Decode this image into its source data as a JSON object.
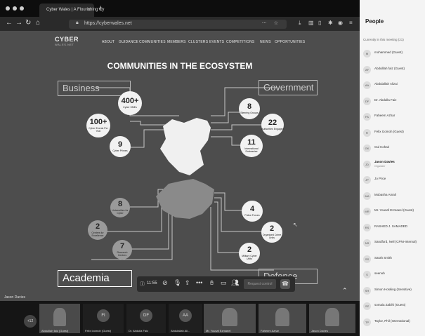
{
  "browser": {
    "tab_title": "Cyber Wales | A Flourishing Cy",
    "url": "https://cyberwales.net"
  },
  "site": {
    "logo_text": "CYBER",
    "logo_sub": "WALES.NET",
    "nav": [
      "ABOUT",
      "GUIDANCE",
      "COMMUNITIES",
      "MEMBERS",
      "CLUSTERS",
      "EVENTS",
      "COMPETITIONS",
      "NEWS",
      "OPPORTUNITIES"
    ],
    "title": "COMMUNITIES IN THE ECOSYSTEM",
    "sectors": {
      "business": "Business",
      "government": "Government",
      "academia": "Academia",
      "defence": "Defence"
    },
    "stats": {
      "business": [
        {
          "n": "400+",
          "l": "Cyber SMEs"
        },
        {
          "n": "100+",
          "l": "Cyber Events Per Year"
        },
        {
          "n": "9",
          "l": "Cyber Primes"
        }
      ],
      "government": [
        {
          "n": "8",
          "l": "Steering Groups"
        },
        {
          "n": "22",
          "l": "Authorities Engaged"
        },
        {
          "n": "11",
          "l": "International Embassies"
        }
      ],
      "academia": [
        {
          "n": "8",
          "l": "Universities for Cyber"
        },
        {
          "n": "2",
          "l": "Centres for Excellence"
        },
        {
          "n": "7",
          "l": "Research Centres"
        }
      ],
      "defence": [
        {
          "n": "4",
          "l": "Police Forces"
        },
        {
          "n": "2",
          "l": "Organised Crime Units"
        },
        {
          "n": "2",
          "l": "Military Cyber Units"
        }
      ]
    }
  },
  "call": {
    "timer": "11:55",
    "request_control": "Request control",
    "presenter": "Jason Davies"
  },
  "people": {
    "title": "People",
    "section": "Currently in this meeting (21)",
    "list": [
      {
        "i": "M",
        "name": "mohammed (Guest)"
      },
      {
        "i": "AF",
        "name": "Abdulllah faiz (Guest)"
      },
      {
        "i": "AA",
        "name": "Abdulallah Alizai"
      },
      {
        "i": "DF",
        "name": "Dr. Abdulla Faiz"
      },
      {
        "i": "FA",
        "name": "Faheem Azhar"
      },
      {
        "i": "FI",
        "name": "Felix Izomoh (Guest)"
      },
      {
        "i": "GK",
        "name": "Gul Kohari"
      },
      {
        "i": "JD",
        "name": "Jason Davies",
        "role": "Organizer"
      },
      {
        "i": "JP",
        "name": "Jo Price"
      },
      {
        "i": "MA",
        "name": "Mobasha Amali"
      },
      {
        "i": "MR",
        "name": "Mr. Yousaf Ezmaeel (Guest)"
      },
      {
        "i": "RS",
        "name": "RASHED J. SAMADED"
      },
      {
        "i": "NS",
        "name": "Sandford, Neil (CPNI-Internal)"
      },
      {
        "i": "SS",
        "name": "Sarah Smith"
      },
      {
        "i": "S",
        "name": "seenub"
      },
      {
        "i": "SH",
        "name": "Simon Hosking (Sensitive)"
      },
      {
        "i": "SZ",
        "name": "somaia Zabihi (Guest)"
      },
      {
        "i": "TP",
        "name": "Taylor, Phil (International)"
      }
    ]
  },
  "participants_strip": {
    "overflow": "+12",
    "tiles": [
      {
        "i": "",
        "name": "Abdulllah faiz (Guest)"
      },
      {
        "i": "FI",
        "name": "Felix Izomoh (Guest)"
      },
      {
        "i": "DF",
        "name": "Dr. Abdulla Faiz"
      },
      {
        "i": "AA",
        "name": "Abdulallah Ali..."
      },
      {
        "i": "",
        "name": "Mr. Yousaf Ezmaeel"
      },
      {
        "i": "",
        "name": "Faheem Azhar"
      },
      {
        "i": "",
        "name": "Jason Davies"
      }
    ]
  }
}
